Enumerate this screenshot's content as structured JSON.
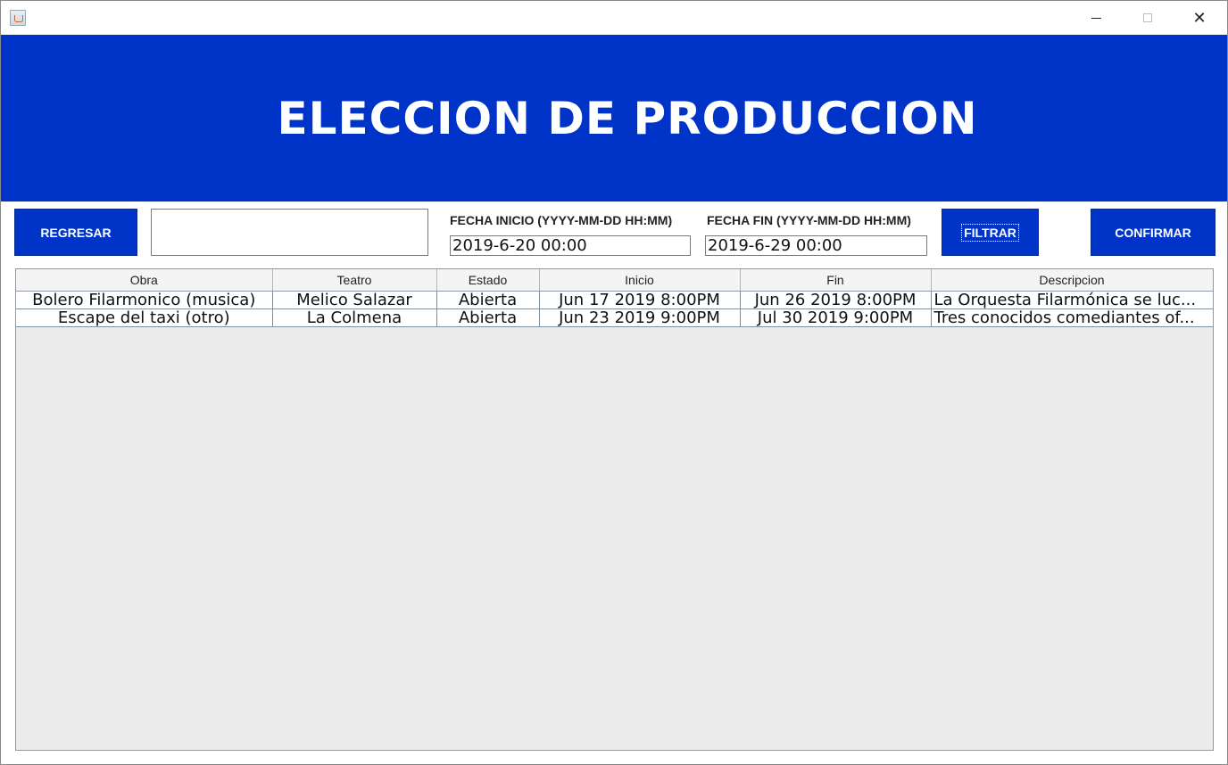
{
  "window": {
    "app_icon": "java-cup-icon",
    "controls": {
      "minimize": "minimize-icon",
      "maximize": "maximize-icon",
      "close": "✕"
    }
  },
  "banner": {
    "title": "ELECCION DE PRODUCCION"
  },
  "toolbar": {
    "back_label": "REGRESAR",
    "search_value": "",
    "start_label": "FECHA INICIO (YYYY-MM-DD HH:MM)",
    "start_value": "2019-6-20 00:00",
    "end_label": "FECHA FIN (YYYY-MM-DD HH:MM)",
    "end_value": "2019-6-29 00:00",
    "filter_label": "FILTRAR",
    "confirm_label": "CONFIRMAR"
  },
  "table": {
    "columns": [
      "Obra",
      "Teatro",
      "Estado",
      "Inicio",
      "Fin",
      "Descripcion"
    ],
    "rows": [
      [
        "Bolero Filarmonico (musica)",
        "Melico Salazar",
        "Abierta",
        "Jun 17 2019  8:00PM",
        "Jun 26 2019  8:00PM",
        "La Orquesta Filarmónica se luc..."
      ],
      [
        "Escape del taxi (otro)",
        "La Colmena",
        "Abierta",
        "Jun 23 2019  9:00PM",
        "Jul 30 2019  9:00PM",
        "Tres conocidos comediantes of..."
      ]
    ]
  },
  "colors": {
    "brand_blue": "#0034c8",
    "table_bg": "#ececec"
  }
}
